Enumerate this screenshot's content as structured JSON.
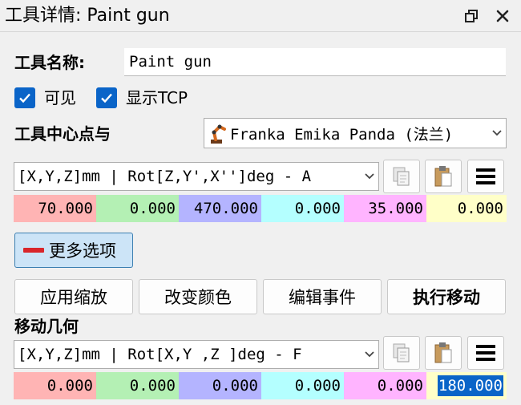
{
  "window": {
    "title": "工具详情: Paint gun"
  },
  "tool": {
    "name_label": "工具名称:",
    "name_value": "Paint gun",
    "visible_label": "可见",
    "visible_checked": true,
    "show_tcp_label": "显示TCP",
    "show_tcp_checked": true,
    "tcp_relative_label": "工具中心点与",
    "reference_value": "Franka Emika Panda (法兰)"
  },
  "pose": {
    "format_value": "[X,Y,Z]mm | Rot[Z,Y',X'']deg - A",
    "values": [
      "70.000",
      "0.000",
      "470.000",
      "0.000",
      "35.000",
      "0.000"
    ]
  },
  "more_options_label": "更多选项",
  "actions": {
    "apply_scale": "应用缩放",
    "change_color": "改变颜色",
    "edit_events": "编辑事件",
    "execute_move": "执行移动"
  },
  "move_geometry": {
    "label": "移动几何",
    "format_value": "[X,Y,Z]mm | Rot[X,Y ,Z  ]deg - F",
    "values": [
      "0.000",
      "0.000",
      "0.000",
      "0.000",
      "0.000",
      "180.000"
    ],
    "selected_index": 5
  },
  "colors": {
    "x": "#ffb4b4",
    "y": "#b4f0b4",
    "z": "#b4b4ff",
    "rx": "#b4ffff",
    "ry": "#ffb4ff",
    "rz": "#ffffc8",
    "accent": "#0a64c8",
    "more_options_bg": "#cce4f7"
  },
  "icons": [
    "restore-icon",
    "close-icon",
    "check-icon",
    "robot-icon",
    "chevron-down-icon",
    "copy-icon",
    "paste-icon",
    "menu-icon",
    "minus-icon"
  ]
}
